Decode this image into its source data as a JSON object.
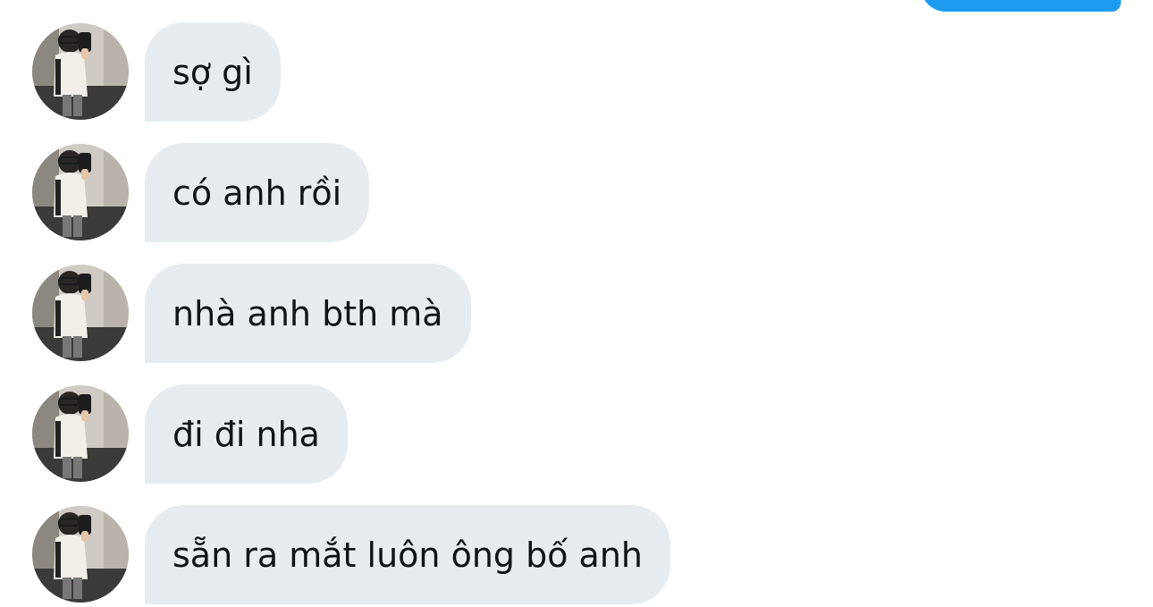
{
  "conversation": {
    "messages": [
      {
        "text": "sợ gì"
      },
      {
        "text": "có anh rồi"
      },
      {
        "text": "nhà anh bth mà"
      },
      {
        "text": "đi đi nha"
      },
      {
        "text": "sẵn ra mắt luôn ông bố anh"
      }
    ]
  },
  "colors": {
    "incoming_bubble": "#e7ecf0",
    "outgoing_bubble": "#1d9bf0",
    "text": "#0f1419"
  }
}
